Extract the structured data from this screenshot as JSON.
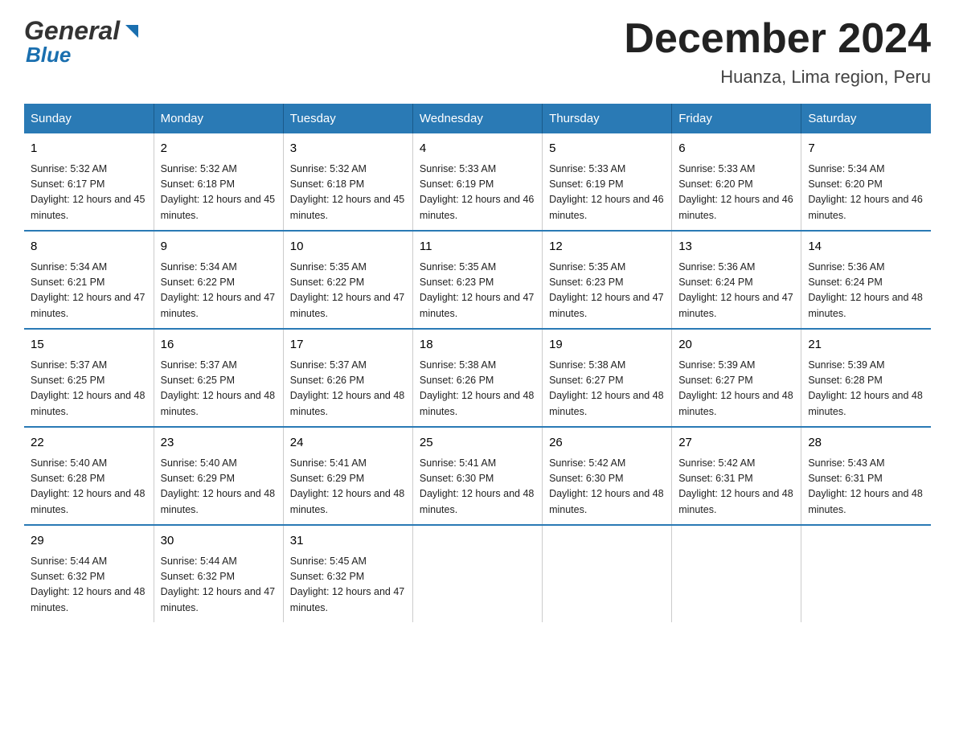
{
  "logo": {
    "text_general": "General",
    "text_blue": "Blue",
    "arrow": "▶"
  },
  "header": {
    "title": "December 2024",
    "subtitle": "Huanza, Lima region, Peru"
  },
  "columns": [
    "Sunday",
    "Monday",
    "Tuesday",
    "Wednesday",
    "Thursday",
    "Friday",
    "Saturday"
  ],
  "weeks": [
    [
      {
        "day": "1",
        "sunrise": "Sunrise: 5:32 AM",
        "sunset": "Sunset: 6:17 PM",
        "daylight": "Daylight: 12 hours and 45 minutes."
      },
      {
        "day": "2",
        "sunrise": "Sunrise: 5:32 AM",
        "sunset": "Sunset: 6:18 PM",
        "daylight": "Daylight: 12 hours and 45 minutes."
      },
      {
        "day": "3",
        "sunrise": "Sunrise: 5:32 AM",
        "sunset": "Sunset: 6:18 PM",
        "daylight": "Daylight: 12 hours and 45 minutes."
      },
      {
        "day": "4",
        "sunrise": "Sunrise: 5:33 AM",
        "sunset": "Sunset: 6:19 PM",
        "daylight": "Daylight: 12 hours and 46 minutes."
      },
      {
        "day": "5",
        "sunrise": "Sunrise: 5:33 AM",
        "sunset": "Sunset: 6:19 PM",
        "daylight": "Daylight: 12 hours and 46 minutes."
      },
      {
        "day": "6",
        "sunrise": "Sunrise: 5:33 AM",
        "sunset": "Sunset: 6:20 PM",
        "daylight": "Daylight: 12 hours and 46 minutes."
      },
      {
        "day": "7",
        "sunrise": "Sunrise: 5:34 AM",
        "sunset": "Sunset: 6:20 PM",
        "daylight": "Daylight: 12 hours and 46 minutes."
      }
    ],
    [
      {
        "day": "8",
        "sunrise": "Sunrise: 5:34 AM",
        "sunset": "Sunset: 6:21 PM",
        "daylight": "Daylight: 12 hours and 47 minutes."
      },
      {
        "day": "9",
        "sunrise": "Sunrise: 5:34 AM",
        "sunset": "Sunset: 6:22 PM",
        "daylight": "Daylight: 12 hours and 47 minutes."
      },
      {
        "day": "10",
        "sunrise": "Sunrise: 5:35 AM",
        "sunset": "Sunset: 6:22 PM",
        "daylight": "Daylight: 12 hours and 47 minutes."
      },
      {
        "day": "11",
        "sunrise": "Sunrise: 5:35 AM",
        "sunset": "Sunset: 6:23 PM",
        "daylight": "Daylight: 12 hours and 47 minutes."
      },
      {
        "day": "12",
        "sunrise": "Sunrise: 5:35 AM",
        "sunset": "Sunset: 6:23 PM",
        "daylight": "Daylight: 12 hours and 47 minutes."
      },
      {
        "day": "13",
        "sunrise": "Sunrise: 5:36 AM",
        "sunset": "Sunset: 6:24 PM",
        "daylight": "Daylight: 12 hours and 47 minutes."
      },
      {
        "day": "14",
        "sunrise": "Sunrise: 5:36 AM",
        "sunset": "Sunset: 6:24 PM",
        "daylight": "Daylight: 12 hours and 48 minutes."
      }
    ],
    [
      {
        "day": "15",
        "sunrise": "Sunrise: 5:37 AM",
        "sunset": "Sunset: 6:25 PM",
        "daylight": "Daylight: 12 hours and 48 minutes."
      },
      {
        "day": "16",
        "sunrise": "Sunrise: 5:37 AM",
        "sunset": "Sunset: 6:25 PM",
        "daylight": "Daylight: 12 hours and 48 minutes."
      },
      {
        "day": "17",
        "sunrise": "Sunrise: 5:37 AM",
        "sunset": "Sunset: 6:26 PM",
        "daylight": "Daylight: 12 hours and 48 minutes."
      },
      {
        "day": "18",
        "sunrise": "Sunrise: 5:38 AM",
        "sunset": "Sunset: 6:26 PM",
        "daylight": "Daylight: 12 hours and 48 minutes."
      },
      {
        "day": "19",
        "sunrise": "Sunrise: 5:38 AM",
        "sunset": "Sunset: 6:27 PM",
        "daylight": "Daylight: 12 hours and 48 minutes."
      },
      {
        "day": "20",
        "sunrise": "Sunrise: 5:39 AM",
        "sunset": "Sunset: 6:27 PM",
        "daylight": "Daylight: 12 hours and 48 minutes."
      },
      {
        "day": "21",
        "sunrise": "Sunrise: 5:39 AM",
        "sunset": "Sunset: 6:28 PM",
        "daylight": "Daylight: 12 hours and 48 minutes."
      }
    ],
    [
      {
        "day": "22",
        "sunrise": "Sunrise: 5:40 AM",
        "sunset": "Sunset: 6:28 PM",
        "daylight": "Daylight: 12 hours and 48 minutes."
      },
      {
        "day": "23",
        "sunrise": "Sunrise: 5:40 AM",
        "sunset": "Sunset: 6:29 PM",
        "daylight": "Daylight: 12 hours and 48 minutes."
      },
      {
        "day": "24",
        "sunrise": "Sunrise: 5:41 AM",
        "sunset": "Sunset: 6:29 PM",
        "daylight": "Daylight: 12 hours and 48 minutes."
      },
      {
        "day": "25",
        "sunrise": "Sunrise: 5:41 AM",
        "sunset": "Sunset: 6:30 PM",
        "daylight": "Daylight: 12 hours and 48 minutes."
      },
      {
        "day": "26",
        "sunrise": "Sunrise: 5:42 AM",
        "sunset": "Sunset: 6:30 PM",
        "daylight": "Daylight: 12 hours and 48 minutes."
      },
      {
        "day": "27",
        "sunrise": "Sunrise: 5:42 AM",
        "sunset": "Sunset: 6:31 PM",
        "daylight": "Daylight: 12 hours and 48 minutes."
      },
      {
        "day": "28",
        "sunrise": "Sunrise: 5:43 AM",
        "sunset": "Sunset: 6:31 PM",
        "daylight": "Daylight: 12 hours and 48 minutes."
      }
    ],
    [
      {
        "day": "29",
        "sunrise": "Sunrise: 5:44 AM",
        "sunset": "Sunset: 6:32 PM",
        "daylight": "Daylight: 12 hours and 48 minutes."
      },
      {
        "day": "30",
        "sunrise": "Sunrise: 5:44 AM",
        "sunset": "Sunset: 6:32 PM",
        "daylight": "Daylight: 12 hours and 47 minutes."
      },
      {
        "day": "31",
        "sunrise": "Sunrise: 5:45 AM",
        "sunset": "Sunset: 6:32 PM",
        "daylight": "Daylight: 12 hours and 47 minutes."
      },
      null,
      null,
      null,
      null
    ]
  ]
}
